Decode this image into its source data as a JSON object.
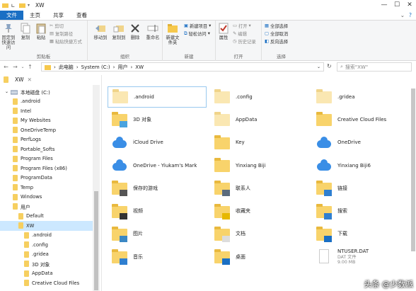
{
  "window": {
    "title": "XW"
  },
  "tabs": [
    {
      "label": "文件"
    },
    {
      "label": "主页"
    },
    {
      "label": "共享"
    },
    {
      "label": "查看"
    }
  ],
  "ribbon": {
    "clipboard": {
      "label": "剪贴板",
      "pin": "固定到快速访问",
      "copy": "复制",
      "paste": "粘贴",
      "cut": "剪切",
      "copy_path": "复制路径",
      "paste_shortcut": "粘贴快捷方式"
    },
    "organize": {
      "label": "组织",
      "move_to": "移动到",
      "copy_to": "复制到",
      "delete": "删除",
      "rename": "重命名"
    },
    "new": {
      "label": "新建",
      "new_folder": "新建文件夹",
      "new_item": "新建项目",
      "easy_access": "轻松访问"
    },
    "open": {
      "label": "打开",
      "properties": "属性",
      "open": "打开",
      "edit": "编辑",
      "history": "历史记录"
    },
    "select": {
      "label": "选择",
      "select_all": "全部选择",
      "select_none": "全部取消",
      "invert": "反向选择"
    }
  },
  "address": {
    "path": [
      "此电脑",
      "System (C:)",
      "用户",
      "XW"
    ],
    "search_placeholder": "搜索\"XW\""
  },
  "sidebar": {
    "pinned_label": "XW",
    "drive": "本地磁盘 (C:)",
    "items": [
      {
        "label": ".android",
        "indent": 1
      },
      {
        "label": "Intel",
        "indent": 1
      },
      {
        "label": "My Websites",
        "indent": 1
      },
      {
        "label": "OneDriveTemp",
        "indent": 1
      },
      {
        "label": "PerfLogs",
        "indent": 1
      },
      {
        "label": "Portable_Softs",
        "indent": 1
      },
      {
        "label": "Program Files",
        "indent": 1
      },
      {
        "label": "Program Files (x86)",
        "indent": 1
      },
      {
        "label": "ProgramData",
        "indent": 1
      },
      {
        "label": "Temp",
        "indent": 1
      },
      {
        "label": "Windows",
        "indent": 1
      },
      {
        "label": "用户",
        "indent": 1
      },
      {
        "label": "Default",
        "indent": 2
      },
      {
        "label": "XW",
        "indent": 2,
        "selected": true
      },
      {
        "label": ".android",
        "indent": 3
      },
      {
        "label": ".config",
        "indent": 3
      },
      {
        "label": ".gridea",
        "indent": 3
      },
      {
        "label": "3D 对象",
        "indent": 3
      },
      {
        "label": "AppData",
        "indent": 3
      },
      {
        "label": "Creative Cloud Files",
        "indent": 3
      }
    ]
  },
  "files": [
    {
      "name": ".android",
      "icon": "folder-dim",
      "selected": true
    },
    {
      "name": ".config",
      "icon": "folder-dim"
    },
    {
      "name": ".gridea",
      "icon": "folder-dim"
    },
    {
      "name": "3D 对象",
      "icon": "folder-3d"
    },
    {
      "name": "AppData",
      "icon": "folder-dim"
    },
    {
      "name": "Creative Cloud Files",
      "icon": "folder"
    },
    {
      "name": "iCloud Drive",
      "icon": "cloud"
    },
    {
      "name": "Key",
      "icon": "folder"
    },
    {
      "name": "OneDrive",
      "icon": "cloud"
    },
    {
      "name": "OneDrive - Yiukam's Mark",
      "icon": "cloud"
    },
    {
      "name": "Yinxiang Biji",
      "icon": "folder"
    },
    {
      "name": "Yinxiang Biji6",
      "icon": "cloud"
    },
    {
      "name": "保存的游戏",
      "icon": "folder-games"
    },
    {
      "name": "联系人",
      "icon": "folder-contacts"
    },
    {
      "name": "链接",
      "icon": "folder-links"
    },
    {
      "name": "视频",
      "icon": "folder-video"
    },
    {
      "name": "收藏夹",
      "icon": "folder-fav"
    },
    {
      "name": "搜索",
      "icon": "folder-search"
    },
    {
      "name": "图片",
      "icon": "folder-pictures"
    },
    {
      "name": "文档",
      "icon": "folder-docs"
    },
    {
      "name": "下载",
      "icon": "folder-download"
    },
    {
      "name": "音乐",
      "icon": "folder-music"
    },
    {
      "name": "桌面",
      "icon": "folder-desktop"
    },
    {
      "name": "NTUSER.DAT",
      "icon": "file",
      "type": "DAT 文件",
      "size": "9.00 MB"
    }
  ],
  "watermark": "头条 @少数派"
}
